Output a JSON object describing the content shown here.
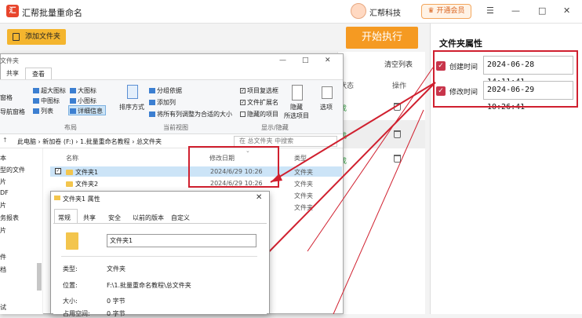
{
  "app": {
    "logo_char": "汇",
    "title": "汇帮批量重命名",
    "user_name": "汇帮科技",
    "vip_label": "开通会员",
    "window_controls": [
      "☰",
      "—",
      "□",
      "✕"
    ]
  },
  "toolbar": {
    "add_folder_label": "添加文件夹",
    "start_label": "开始执行"
  },
  "list": {
    "clear_label": "清空列表",
    "col_status": "状态",
    "col_op": "操作",
    "rows": [
      {
        "status": "成"
      },
      {
        "status": "成"
      },
      {
        "status": "成"
      }
    ]
  },
  "right_panel": {
    "title": "文件夹属性",
    "created_label": "创建时间",
    "created_value": "2024-06-28 14:11:41",
    "modified_label": "修改时间",
    "modified_value": "2024-06-29 10:26:41"
  },
  "explorer": {
    "title": "文件夹",
    "tab_share": "共享",
    "tab_view": "查看",
    "ribbon": {
      "pane_label": "导航窗格",
      "preview": "窗格",
      "xl_icons": "超大图标",
      "l_icons": "大图标",
      "m_icons": "中图标",
      "s_icons": "小图标",
      "list": "列表",
      "details": "详细信息",
      "layout_group": "布局",
      "sort": "排序方式",
      "group_by": "分组依据",
      "add_col": "添加列",
      "fit_cols": "将所有列调整为合适的大小",
      "current_view_group": "当前视图",
      "item_chk": "项目复选框",
      "ext": "文件扩展名",
      "hidden": "隐藏的项目",
      "hide_sel": "隐藏",
      "hide_sel2": "所选项目",
      "options": "选项",
      "showhide_group": "显示/隐藏",
      "close": "✕",
      "max": "□",
      "min": "—"
    },
    "address": "此电脑 › 新加卷 (F:) › 1.批量重命名教程 › 总文件夹",
    "search_placeholder": "在 总文件夹 中搜索",
    "nav_items": [
      "本",
      "片",
      "型的文件",
      "片",
      "DF",
      "片",
      "务报表",
      "片",
      "",
      "件",
      "档",
      "",
      "",
      "试"
    ],
    "headers": {
      "name": "名称",
      "date": "修改日期",
      "type": "类型"
    },
    "files": [
      {
        "name": "文件夹1",
        "date": "2024/6/29 10:26",
        "type": "文件夹"
      },
      {
        "name": "文件夹2",
        "date": "2024/6/29 10:26",
        "type": "文件夹"
      }
    ],
    "extra_types": [
      "文件夹",
      "文件夹"
    ]
  },
  "properties": {
    "title": "文件夹1 属性",
    "tabs": [
      "常规",
      "共享",
      "安全",
      "以前的版本",
      "自定义"
    ],
    "name": "文件夹1",
    "type_label": "类型:",
    "type_value": "文件夹",
    "location_label": "位置:",
    "location_value": "F:\\1.批量重命名教程\\总文件夹",
    "size_label": "大小:",
    "size_value": "0 字节",
    "sod_label": "占用空间:",
    "sod_value": "0 字节",
    "close": "✕"
  },
  "colors": {
    "accent_orange": "#f59a22",
    "add_btn": "#f4b52e",
    "highlight_red": "#d0202f",
    "check_red": "#c8354b"
  }
}
